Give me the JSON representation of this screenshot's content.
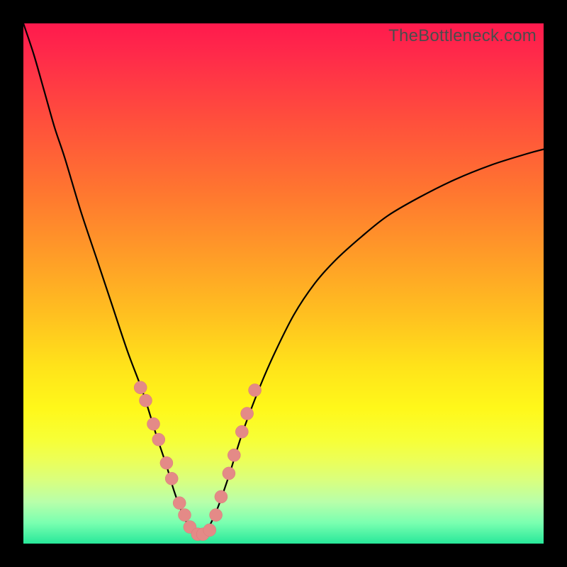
{
  "watermark": "TheBottleneck.com",
  "chart_data": {
    "type": "line",
    "title": "",
    "xlabel": "",
    "ylabel": "",
    "xlim": [
      0,
      1
    ],
    "ylim": [
      0,
      1
    ],
    "series": [
      {
        "name": "curve",
        "x": [
          0.0,
          0.02,
          0.04,
          0.06,
          0.08,
          0.11,
          0.14,
          0.17,
          0.2,
          0.23,
          0.255,
          0.275,
          0.29,
          0.305,
          0.32,
          0.335,
          0.35,
          0.37,
          0.395,
          0.42,
          0.45,
          0.48,
          0.52,
          0.56,
          0.6,
          0.65,
          0.7,
          0.76,
          0.83,
          0.9,
          0.97,
          1.0
        ],
        "y": [
          1.0,
          0.94,
          0.87,
          0.8,
          0.74,
          0.64,
          0.55,
          0.46,
          0.37,
          0.29,
          0.21,
          0.15,
          0.1,
          0.06,
          0.03,
          0.018,
          0.023,
          0.06,
          0.13,
          0.21,
          0.29,
          0.36,
          0.44,
          0.5,
          0.545,
          0.59,
          0.63,
          0.665,
          0.7,
          0.728,
          0.75,
          0.758
        ]
      }
    ],
    "markers": {
      "name": "highlighted-points",
      "color": "#e48a87",
      "x": [
        0.225,
        0.235,
        0.25,
        0.26,
        0.275,
        0.285,
        0.3,
        0.31,
        0.32,
        0.335,
        0.345,
        0.358,
        0.37,
        0.38,
        0.395,
        0.405,
        0.42,
        0.43,
        0.445
      ],
      "y": [
        0.3,
        0.275,
        0.23,
        0.2,
        0.155,
        0.125,
        0.078,
        0.055,
        0.032,
        0.018,
        0.018,
        0.026,
        0.055,
        0.09,
        0.135,
        0.17,
        0.215,
        0.25,
        0.295
      ]
    }
  }
}
